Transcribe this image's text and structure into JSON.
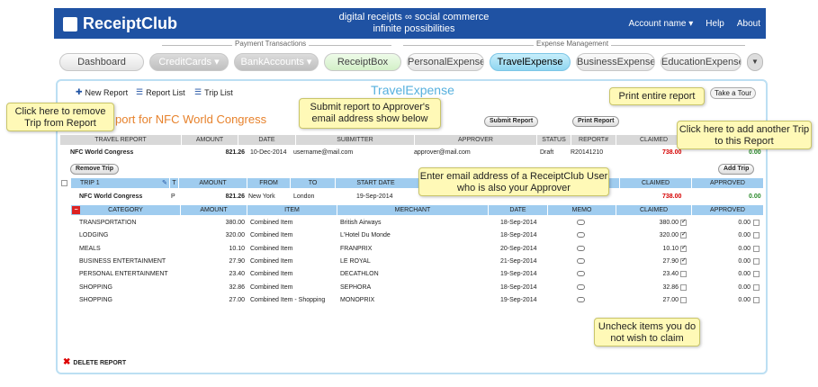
{
  "brand": {
    "name": "ReceiptClub",
    "tagline1": "digital receipts ∞ social commerce",
    "tagline2": "infinite possibilities"
  },
  "topnav": {
    "account": "Account name ▾",
    "help": "Help",
    "about": "About"
  },
  "groups": {
    "payment": "Payment Transactions",
    "expense": "Expense Management"
  },
  "tabs": [
    "Dashboard",
    "CreditCards ▾",
    "BankAccounts ▾",
    "ReceiptBox",
    "PersonalExpense",
    "TravelExpense",
    "BusinessExpense",
    "EducationExpense"
  ],
  "toolbar": {
    "new_report": "New Report",
    "report_list": "Report List",
    "trip_list": "Trip List",
    "page_title": "TravelExpense",
    "tour": "Take a Tour"
  },
  "report": {
    "title": "port for NFC World Congress",
    "headers": [
      "TRAVEL REPORT",
      "AMOUNT",
      "DATE",
      "SUBMITTER",
      "APPROVER",
      "STATUS",
      "REPORT#",
      "CLAIMED"
    ],
    "name": "NFC World Congress",
    "amount": "821.26",
    "date": "10-Dec-2014",
    "submitter": "username@mail.com",
    "approver": "approver@mail.com",
    "status": "Draft",
    "report_no": "R20141210",
    "claimed": "738.00",
    "approved": "0.00",
    "submit_btn": "Submit Report",
    "print_btn": "Print Report",
    "remove_trip": "Remove Trip",
    "add_trip": "Add Trip"
  },
  "trip": {
    "headers": [
      "TRIP 1",
      "T",
      "AMOUNT",
      "FROM",
      "TO",
      "START DATE",
      "",
      "CLAIMED",
      "APPROVED"
    ],
    "name": "NFC World Congress",
    "type": "P",
    "amount": "821.26",
    "from": "New York",
    "to": "London",
    "start": "19-Sep-2014",
    "claimed": "738.00",
    "approved": "0.00"
  },
  "items": {
    "headers": [
      "CATEGORY",
      "AMOUNT",
      "ITEM",
      "MERCHANT",
      "DATE",
      "MEMO",
      "CLAIMED",
      "APPROVED"
    ],
    "rows": [
      {
        "cat": "TRANSPORTATION",
        "amt": "380.00",
        "item": "Combined Item",
        "merchant": "British Airways",
        "date": "18-Sep-2014",
        "claimed": "380.00",
        "chk": true,
        "appr": "0.00"
      },
      {
        "cat": "LODGING",
        "amt": "320.00",
        "item": "Combined Item",
        "merchant": "L'Hotel Du Monde",
        "date": "18-Sep-2014",
        "claimed": "320.00",
        "chk": true,
        "appr": "0.00"
      },
      {
        "cat": "MEALS",
        "amt": "10.10",
        "item": "Combined Item",
        "merchant": "FRANPRIX",
        "date": "20-Sep-2014",
        "claimed": "10.10",
        "chk": true,
        "appr": "0.00"
      },
      {
        "cat": "BUSINESS ENTERTAINMENT",
        "amt": "27.90",
        "item": "Combined Item",
        "merchant": "LE ROYAL",
        "date": "21-Sep-2014",
        "claimed": "27.90",
        "chk": true,
        "appr": "0.00"
      },
      {
        "cat": "PERSONAL ENTERTAINMENT",
        "amt": "23.40",
        "item": "Combined Item",
        "merchant": "DECATHLON",
        "date": "19-Sep-2014",
        "claimed": "23.40",
        "chk": false,
        "appr": "0.00"
      },
      {
        "cat": "SHOPPING",
        "amt": "32.86",
        "item": "Combined Item",
        "merchant": "SEPHORA",
        "date": "18-Sep-2014",
        "claimed": "32.86",
        "chk": false,
        "appr": "0.00"
      },
      {
        "cat": "SHOPPING",
        "amt": "27.00",
        "item": "Combined Item - Shopping",
        "merchant": "MONOPRIX",
        "date": "19-Sep-2014",
        "claimed": "27.00",
        "chk": false,
        "appr": "0.00"
      }
    ]
  },
  "delete": "DELETE REPORT",
  "callouts": {
    "remove": "Click here to remove Trip from Report",
    "submit": "Submit report to Approver's email address show below",
    "print": "Print entire report",
    "add": "Click here to add another Trip to this Report",
    "approver": "Enter email address of a ReceiptClub User who is also your Approver",
    "uncheck": "Uncheck items you do not wish to claim"
  }
}
